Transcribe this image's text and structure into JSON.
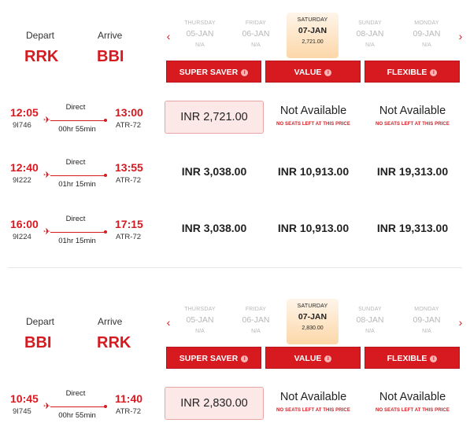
{
  "legs": [
    {
      "depart_label": "Depart",
      "arrive_label": "Arrive",
      "from": "RRK",
      "to": "BBI",
      "dates": [
        {
          "dow": "THURSDAY",
          "date": "05-JAN",
          "price": "N/A",
          "selected": false
        },
        {
          "dow": "FRIDAY",
          "date": "06-JAN",
          "price": "N/A",
          "selected": false
        },
        {
          "dow": "SATURDAY",
          "date": "07-JAN",
          "price": "2,721.00",
          "selected": true
        },
        {
          "dow": "SUNDAY",
          "date": "08-JAN",
          "price": "N/A",
          "selected": false
        },
        {
          "dow": "MONDAY",
          "date": "09-JAN",
          "price": "N/A",
          "selected": false
        }
      ],
      "fare_types": [
        "SUPER SAVER",
        "VALUE",
        "FLEXIBLE"
      ],
      "flights": [
        {
          "dep": "12:05",
          "arr": "13:00",
          "flight_no": "9I746",
          "aircraft": "ATR-72",
          "stops": "Direct",
          "duration": "00hr 55min",
          "fares": [
            "INR 2,721.00",
            "Not Available",
            "Not Available"
          ]
        },
        {
          "dep": "12:40",
          "arr": "13:55",
          "flight_no": "9I222",
          "aircraft": "ATR-72",
          "stops": "Direct",
          "duration": "01hr 15min",
          "fares": [
            "INR 3,038.00",
            "INR 10,913.00",
            "INR 19,313.00"
          ]
        },
        {
          "dep": "16:00",
          "arr": "17:15",
          "flight_no": "9I224",
          "aircraft": "ATR-72",
          "stops": "Direct",
          "duration": "01hr 15min",
          "fares": [
            "INR 3,038.00",
            "INR 10,913.00",
            "INR 19,313.00"
          ]
        }
      ]
    },
    {
      "depart_label": "Depart",
      "arrive_label": "Arrive",
      "from": "BBI",
      "to": "RRK",
      "dates": [
        {
          "dow": "THURSDAY",
          "date": "05-JAN",
          "price": "N/A",
          "selected": false
        },
        {
          "dow": "FRIDAY",
          "date": "06-JAN",
          "price": "N/A",
          "selected": false
        },
        {
          "dow": "SATURDAY",
          "date": "07-JAN",
          "price": "2,830.00",
          "selected": true
        },
        {
          "dow": "SUNDAY",
          "date": "08-JAN",
          "price": "N/A",
          "selected": false
        },
        {
          "dow": "MONDAY",
          "date": "09-JAN",
          "price": "N/A",
          "selected": false
        }
      ],
      "fare_types": [
        "SUPER SAVER",
        "VALUE",
        "FLEXIBLE"
      ],
      "flights": [
        {
          "dep": "10:45",
          "arr": "11:40",
          "flight_no": "9I745",
          "aircraft": "ATR-72",
          "stops": "Direct",
          "duration": "00hr 55min",
          "fares": [
            "INR 2,830.00",
            "Not Available",
            "Not Available"
          ]
        }
      ]
    }
  ],
  "no_seats_text": "NO SEATS LEFT AT THIS PRICE",
  "prev_arrow": "‹",
  "next_arrow": "›",
  "info_glyph": "i",
  "plane_glyph": "✈",
  "colors": {
    "accent": "#d71920",
    "selected_date": "#fcd7a8",
    "best_fare_bg": "#fde8e8"
  }
}
